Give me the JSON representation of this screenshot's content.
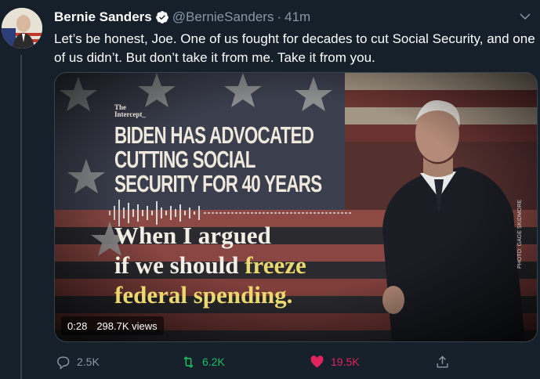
{
  "tweet": {
    "author_name": "Bernie Sanders",
    "handle": "@BernieSanders",
    "separator": "·",
    "time": "41m",
    "text": "Let’s be honest, Joe. One of us fought for decades to cut Social Security, and one of us didn’t. But don’t take it from me. Take it from you."
  },
  "video": {
    "logo_line1": "The",
    "logo_line2": "Intercept_",
    "headline_line1": "BIDEN HAS ADVOCATED",
    "headline_line2": "CUTTING SOCIAL",
    "headline_line3": "SECURITY FOR 40 YEARS",
    "quote_line1": "When I argued",
    "quote_line2_a": "if we should ",
    "quote_line2_b": "freeze",
    "quote_line3": "federal spending.",
    "photo_credit": "PHOTO: GAGE SKIDMORE",
    "duration": "0:28",
    "views": "298.7K views"
  },
  "actions": {
    "replies": "2.5K",
    "retweets": "6.2K",
    "likes": "19.5K"
  },
  "colors": {
    "background": "#15202b",
    "secondary_text": "#8899a6",
    "verified_blue": "#1da1f2",
    "retweet_green": "#17bf63",
    "like_red": "#e0245e"
  },
  "icons": [
    "verified-badge-icon",
    "chevron-down-icon",
    "reply-icon",
    "retweet-icon",
    "heart-icon",
    "share-icon"
  ]
}
